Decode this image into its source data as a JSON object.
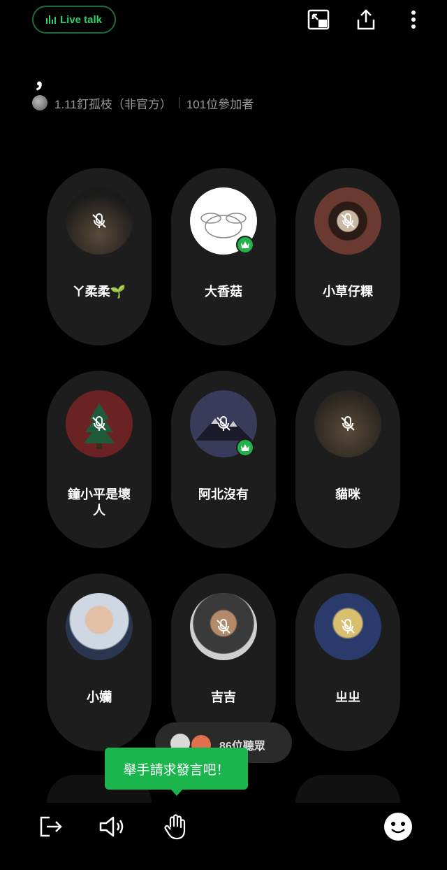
{
  "header": {
    "live_label": "Live talk",
    "title": "，",
    "host_name": "1.11釘孤枝（非官方）",
    "participants": "101位參加者"
  },
  "speakers": [
    {
      "name": "ㄚ柔柔🌱",
      "muted": true,
      "admin": false
    },
    {
      "name": "大香菇",
      "muted": false,
      "admin": true
    },
    {
      "name": "小草仔粿",
      "muted": true,
      "admin": false
    },
    {
      "name": "鐘小平是壞人",
      "muted": true,
      "admin": false
    },
    {
      "name": "阿北沒有",
      "muted": true,
      "admin": true
    },
    {
      "name": "貓咪",
      "muted": true,
      "admin": false
    },
    {
      "name": "小孏",
      "muted": false,
      "admin": false
    },
    {
      "name": "吉吉",
      "muted": true,
      "admin": false
    },
    {
      "name": "ㄓㄓ",
      "muted": true,
      "admin": false
    }
  ],
  "listeners": {
    "count_label": "86位聽眾"
  },
  "tooltip": {
    "text": "舉手請求發言吧！"
  },
  "icons": {
    "top": [
      "pip-icon",
      "share-icon",
      "more-icon"
    ],
    "bottom": [
      "exit-icon",
      "speaker-icon",
      "raise-hand-icon",
      "emoji-icon"
    ]
  },
  "colors": {
    "accent": "#1ab64d",
    "card": "#1d1d1d",
    "background": "#000000"
  }
}
